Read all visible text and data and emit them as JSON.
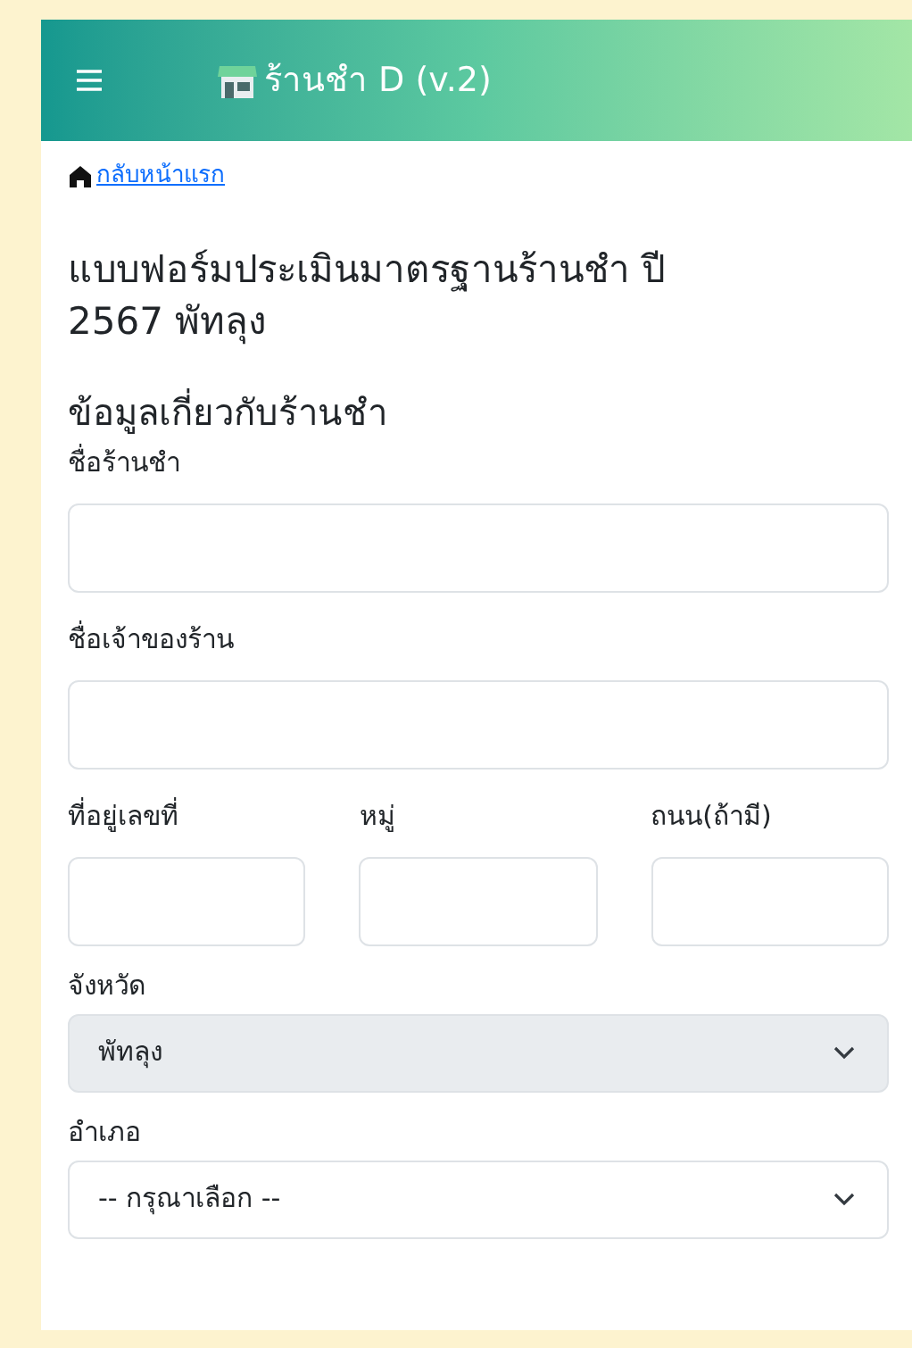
{
  "header": {
    "title": "ร้านชำ D (v.2)"
  },
  "home_link": "กลับหน้าแรก",
  "form_title": "แบบฟอร์มประเมินมาตรฐานร้านชำ ปี 2567 พัทลุง",
  "section_title": "ข้อมูลเกี่ยวกับร้านชำ",
  "rows": [
    [
      {
        "kind": "text",
        "label": "ชื่อร้านชำ"
      }
    ],
    [
      {
        "kind": "text",
        "label": "ชื่อเจ้าของร้าน"
      }
    ],
    [
      {
        "kind": "text",
        "label": "ที่อยู่เลขที่"
      },
      {
        "kind": "text",
        "label": "หมู่"
      },
      {
        "kind": "text",
        "label": "ถนน(ถ้ามี)"
      }
    ],
    [
      {
        "kind": "select",
        "label": "จังหวัด",
        "value": "พัทลุง",
        "disabled": true
      }
    ],
    [
      {
        "kind": "select",
        "label": "อำเภอ",
        "value": "-- กรุณาเลือก --",
        "disabled": false
      }
    ]
  ]
}
